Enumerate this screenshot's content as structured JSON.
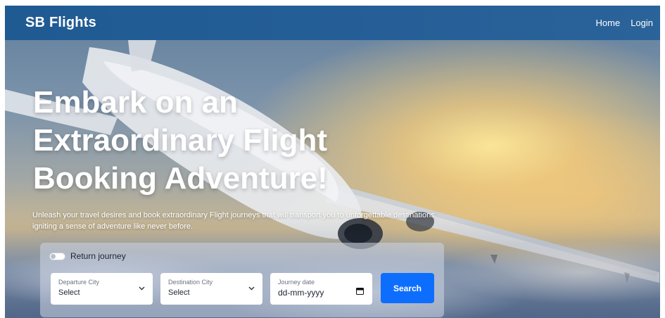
{
  "navbar": {
    "brand": "SB Flights",
    "links": [
      "Home",
      "Login"
    ]
  },
  "hero": {
    "headline": "Embark on an Extraordinary Flight Booking Adventure!",
    "subtext": "Unleash your travel desires and book extraordinary Flight journeys that will transport you to unforgettable destinations, igniting a sense of adventure like never before."
  },
  "search": {
    "return_toggle_label": "Return journey",
    "departure": {
      "label": "Departure City",
      "value": "Select"
    },
    "destination": {
      "label": "Destination City",
      "value": "Select"
    },
    "date": {
      "label": "Journey date",
      "value": "dd-mm-yyyy"
    },
    "button_label": "Search"
  },
  "icons": {
    "departure_dropdown": "chevron-down-icon",
    "destination_dropdown": "chevron-down-icon",
    "date_picker": "calendar-icon",
    "toggle": "toggle-switch"
  },
  "colors": {
    "navbar": "#1f5a93",
    "primary_button": "#0d6efd",
    "text_light": "#ffffff"
  }
}
